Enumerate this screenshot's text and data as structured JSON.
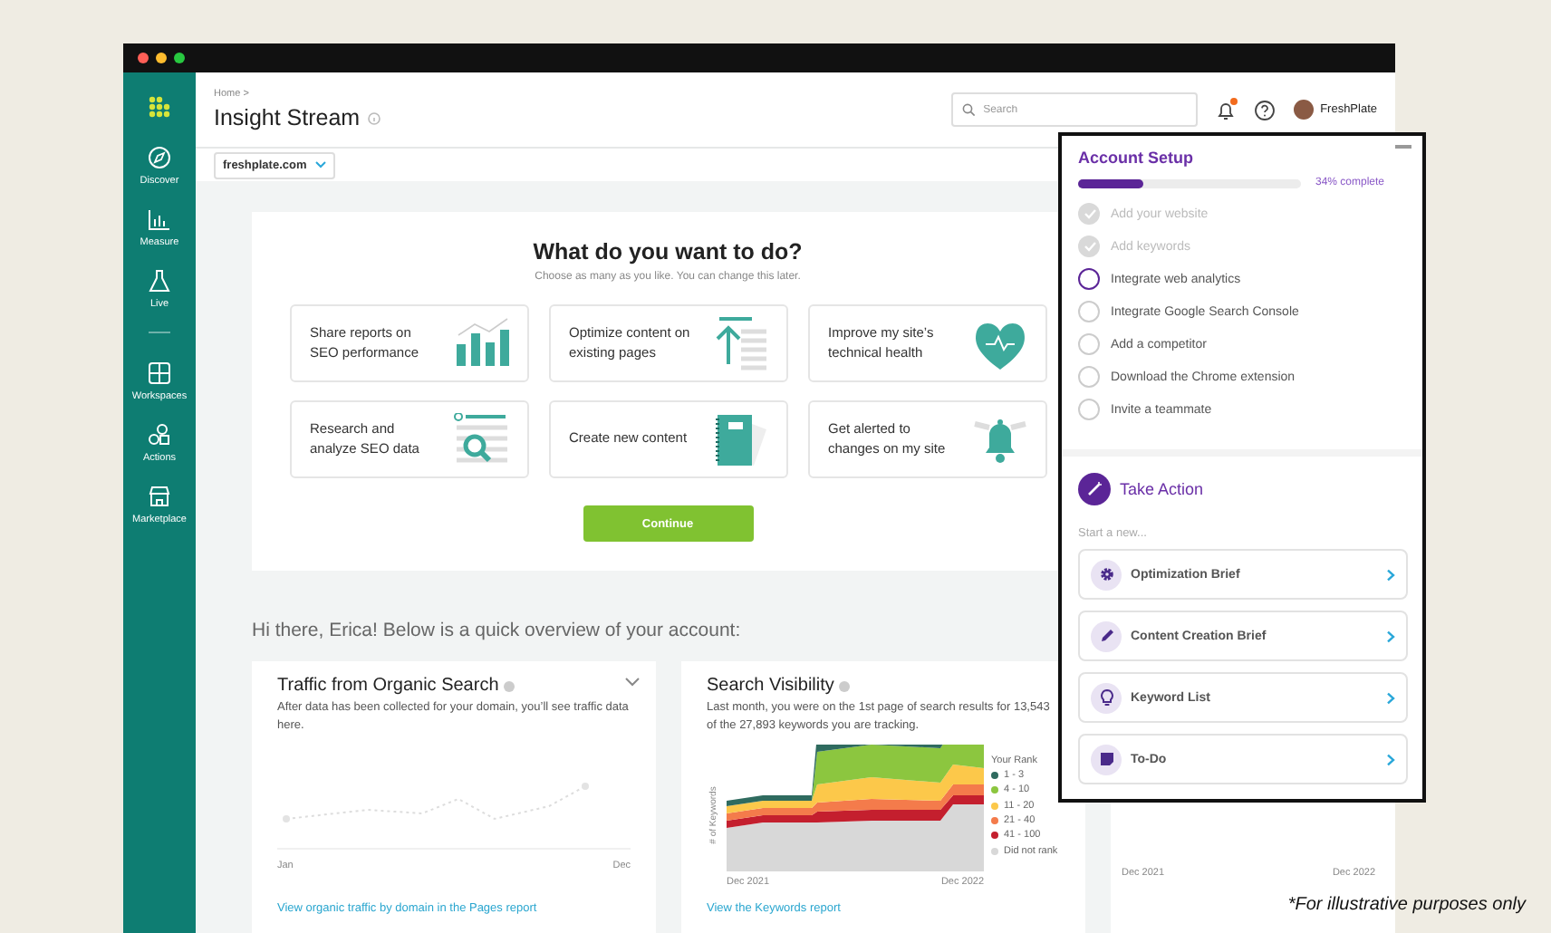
{
  "sidebar": {
    "items": [
      {
        "label": "Discover"
      },
      {
        "label": "Measure"
      },
      {
        "label": "Live"
      },
      {
        "label": "Workspaces"
      },
      {
        "label": "Actions"
      },
      {
        "label": "Marketplace"
      }
    ]
  },
  "header": {
    "breadcrumb": "Home >",
    "title": "Insight Stream",
    "search": {
      "placeholder": "Search"
    },
    "notification": true,
    "user": "FreshPlate"
  },
  "domain_select": {
    "value": "freshplate.com"
  },
  "tasks": {
    "title": "What do you want to do?",
    "subtitle": "Choose as many as you like. You can change this later.",
    "options": [
      {
        "label": "Share reports on SEO performance"
      },
      {
        "label": "Optimize content on existing pages"
      },
      {
        "label": "Improve my site’s technical health"
      },
      {
        "label": "Research and analyze SEO data"
      },
      {
        "label": "Create new content"
      },
      {
        "label": "Get alerted to changes on my site"
      }
    ],
    "button": "Continue"
  },
  "greeting": "Hi there, Erica! Below is a quick overview of your account:",
  "cards": [
    {
      "kind": "traffic",
      "title": "Traffic from Organic Search",
      "description": "After data has been collected for your domain, you’ll see traffic data here.",
      "x_labels": [
        "Jan",
        "Dec"
      ],
      "link": "View organic traffic by domain in the Pages report"
    },
    {
      "kind": "visibility",
      "title": "Search Visibility",
      "description": "Last month, you were on the 1st page of search results for 13,543 of the 27,893 keywords you are tracking.",
      "axis_label": "# of Keywords",
      "x_labels": [
        "Dec 2021",
        "Dec 2022"
      ],
      "legend_title": "Your Rank",
      "legend": [
        {
          "label": "1 - 3",
          "color": "#2f6b5f"
        },
        {
          "label": "4 - 10",
          "color": "#8cc63f"
        },
        {
          "label": "11 - 20",
          "color": "#fcc84a"
        },
        {
          "label": "21 - 40",
          "color": "#f47b4b"
        },
        {
          "label": "41 - 100",
          "color": "#c41f2e"
        },
        {
          "label": "Did not rank",
          "color": "#d8d8d8"
        }
      ],
      "link": "View the Keywords report"
    },
    {
      "kind": "partial",
      "x_labels": [
        "Dec 2021",
        "Dec 2022"
      ]
    }
  ],
  "account_setup": {
    "title": "Account Setup",
    "progress": {
      "level": 0.29,
      "label": "34% complete"
    },
    "steps": [
      {
        "label": "Add your website",
        "checked": true,
        "selected": false
      },
      {
        "label": "Add keywords",
        "checked": true,
        "selected": false
      },
      {
        "label": "Integrate web analytics",
        "checked": false,
        "selected": true
      },
      {
        "label": "Integrate Google Search Console",
        "checked": false,
        "selected": false
      },
      {
        "label": "Add a competitor",
        "checked": false,
        "selected": false
      },
      {
        "label": "Download the Chrome extension",
        "checked": false,
        "selected": false
      },
      {
        "label": "Invite a teammate",
        "checked": false,
        "selected": false
      }
    ],
    "take_action": {
      "title": "Take Action",
      "prompt": "Start a new...",
      "actions": [
        {
          "label": "Optimization Brief"
        },
        {
          "label": "Content Creation Brief"
        },
        {
          "label": "Keyword List"
        },
        {
          "label": "To-Do"
        }
      ]
    }
  },
  "footnote": "*For illustrative purposes only"
}
